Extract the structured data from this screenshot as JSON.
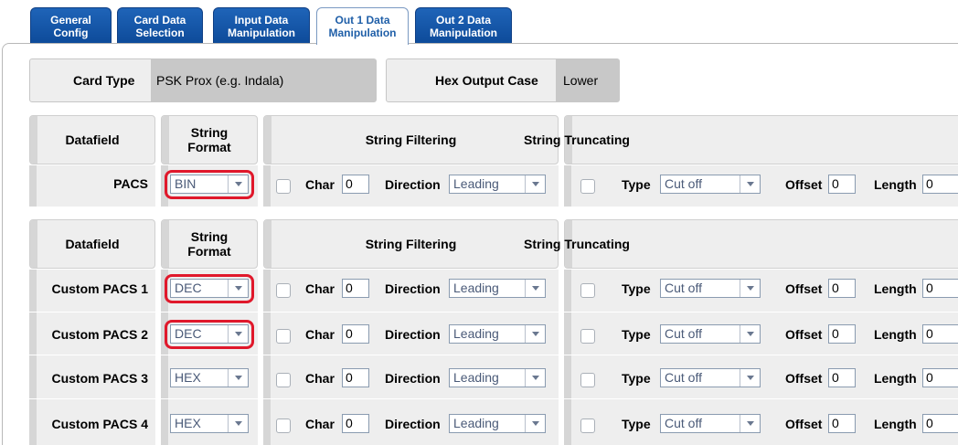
{
  "tabs": [
    {
      "label": "General\nConfig",
      "active": false
    },
    {
      "label": "Card Data\nSelection",
      "active": false
    },
    {
      "label": "Input Data\nManipulation",
      "active": false
    },
    {
      "label": "Out 1 Data\nManipulation",
      "active": true
    },
    {
      "label": "Out 2 Data\nManipulation",
      "active": false
    }
  ],
  "card_type": {
    "label": "Card Type",
    "value": "PSK Prox (e.g. Indala)"
  },
  "hex_output_case": {
    "label": "Hex Output Case",
    "value": "Lower"
  },
  "headers": {
    "datafield": "Datafield",
    "string_format": "String\nFormat",
    "string_filtering": "String Filtering",
    "string_truncating": "String Truncating"
  },
  "labels": {
    "char": "Char",
    "direction": "Direction",
    "type": "Type",
    "offset": "Offset",
    "length": "Length"
  },
  "section1": {
    "rows": [
      {
        "name": "PACS",
        "format": "BIN",
        "char": "0",
        "direction": "Leading",
        "type": "Cut off",
        "offset": "0",
        "length": "0",
        "highlighted": true
      }
    ]
  },
  "section2": {
    "rows": [
      {
        "name": "Custom PACS 1",
        "format": "DEC",
        "char": "0",
        "direction": "Leading",
        "type": "Cut off",
        "offset": "0",
        "length": "0",
        "highlighted": true
      },
      {
        "name": "Custom PACS 2",
        "format": "DEC",
        "char": "0",
        "direction": "Leading",
        "type": "Cut off",
        "offset": "0",
        "length": "0",
        "highlighted": true
      },
      {
        "name": "Custom PACS 3",
        "format": "HEX",
        "char": "0",
        "direction": "Leading",
        "type": "Cut off",
        "offset": "0",
        "length": "0",
        "highlighted": false
      },
      {
        "name": "Custom PACS 4",
        "format": "HEX",
        "char": "0",
        "direction": "Leading",
        "type": "Cut off",
        "offset": "0",
        "length": "0",
        "highlighted": false
      }
    ]
  },
  "colors": {
    "tab_blue": "#0d4a99",
    "highlight_red": "#e0182b"
  }
}
